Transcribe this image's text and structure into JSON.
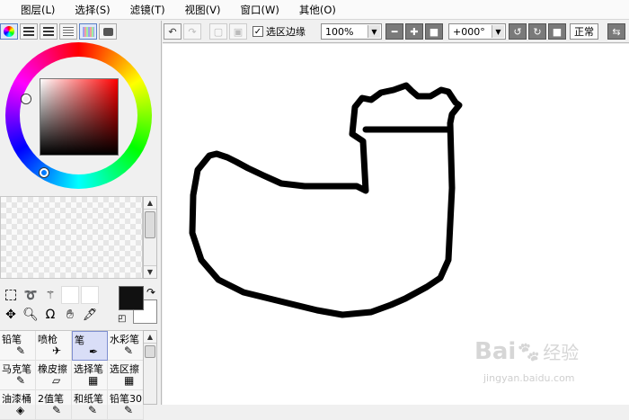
{
  "menu": {
    "items": [
      "图层(L)",
      "选择(S)",
      "滤镜(T)",
      "视图(V)",
      "窗口(W)",
      "其他(O)"
    ]
  },
  "color_panel": {
    "tabs": [
      "color-wheel-icon",
      "rgb-sliders-icon",
      "hsv-sliders-icon",
      "scratch-icon",
      "swatches-icon",
      "palette-icon"
    ],
    "foreground": "#111111",
    "background": "#ffffff",
    "hue_color": "#ff0000"
  },
  "tools": [
    "marquee-icon",
    "lasso-icon",
    "magic-wand-icon",
    "move-icon",
    "zoom-icon",
    "rotate-icon",
    "hand-icon",
    "eyedropper-icon"
  ],
  "brushes": [
    {
      "label": "铅笔",
      "icon": "✎"
    },
    {
      "label": "喷枪",
      "icon": "✈"
    },
    {
      "label": "笔",
      "icon": "✒",
      "selected": true
    },
    {
      "label": "水彩笔",
      "icon": "✎"
    },
    {
      "label": "马克笔",
      "icon": "✎"
    },
    {
      "label": "橡皮擦",
      "icon": "▱"
    },
    {
      "label": "选择笔",
      "icon": "▦"
    },
    {
      "label": "选区擦",
      "icon": "▦"
    },
    {
      "label": "油漆桶",
      "icon": "◈"
    },
    {
      "label": "2值笔",
      "icon": "✎"
    },
    {
      "label": "和纸笔",
      "icon": "✎"
    },
    {
      "label": "铅笔30",
      "icon": "✎"
    }
  ],
  "toolbar": {
    "selection_edge_label": "选区边缘",
    "selection_edge_checked": "✓",
    "zoom_value": "100%",
    "rotation_value": "+000°",
    "blend_mode": "正常"
  },
  "watermark": {
    "logo": "Bai",
    "logo_cn": "经验",
    "sub": "jingyan.baidu.com"
  }
}
